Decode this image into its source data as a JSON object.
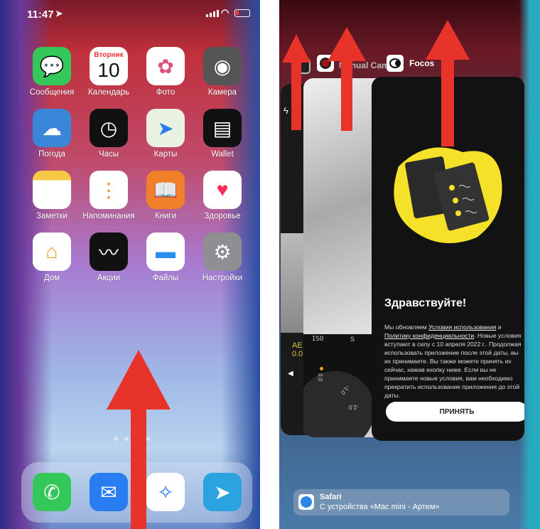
{
  "left_screen": {
    "status_bar": {
      "time": "11:47",
      "location_icon": "location-arrow-icon",
      "signal_icon": "cellular-signal-icon",
      "wifi_icon": "wifi-icon",
      "battery_icon": "battery-low-icon"
    },
    "apps": [
      {
        "label": "Сообщения",
        "icon": "messages-icon",
        "color": "#34c759"
      },
      {
        "label": "Календарь",
        "icon": "calendar-icon",
        "day": "Вторник",
        "date": "10"
      },
      {
        "label": "Фото",
        "icon": "photos-icon"
      },
      {
        "label": "Камера",
        "icon": "camera-icon",
        "color": "#555555"
      },
      {
        "label": "Погода",
        "icon": "weather-icon",
        "color": "#3a86d8"
      },
      {
        "label": "Часы",
        "icon": "clock-icon",
        "color": "#111111"
      },
      {
        "label": "Карты",
        "icon": "maps-icon"
      },
      {
        "label": "Wallet",
        "icon": "wallet-icon",
        "color": "#111111"
      },
      {
        "label": "Заметки",
        "icon": "notes-icon"
      },
      {
        "label": "Напоминания",
        "icon": "reminders-icon"
      },
      {
        "label": "Книги",
        "icon": "books-icon",
        "color": "#f0802a"
      },
      {
        "label": "Здоровье",
        "icon": "health-icon"
      },
      {
        "label": "Дом",
        "icon": "home-icon"
      },
      {
        "label": "Акции",
        "icon": "stocks-icon",
        "color": "#111111"
      },
      {
        "label": "Файлы",
        "icon": "files-icon"
      },
      {
        "label": "Настройки",
        "icon": "settings-icon",
        "color": "#8e8e93"
      }
    ],
    "page_dots": {
      "count": 4,
      "active": 3
    },
    "dock": [
      {
        "icon": "phone-icon",
        "color": "#34c759"
      },
      {
        "icon": "mail-icon",
        "color": "#2a7df0"
      },
      {
        "icon": "safari-icon"
      },
      {
        "icon": "telegram-icon",
        "color": "#2aa3e0"
      }
    ]
  },
  "right_screen": {
    "app_labels": [
      {
        "name": "Manual Cam"
      },
      {
        "name": "Focos"
      }
    ],
    "camera_card": {
      "ae_label": "AE",
      "ae_value": "0.0"
    },
    "manual_card": {
      "iso": "ISO",
      "s": "S",
      "dial": [
        "0.0",
        "-1.0",
        "-2.0"
      ]
    },
    "focos_card": {
      "title": "Здравствуйте!",
      "text_1": "Мы обновляем ",
      "link_terms": "Условия использования",
      "text_2": " и ",
      "link_privacy": "Политику конфиденциальности",
      "text_3": ". Новые условия вступают в силу с 10 апреля 2022 г.. Продолжая использовать приложение после этой даты, вы их принимаете. Вы также можете принять их сейчас, нажав кнопку ниже. Если вы не принимаете новые условия, вам необходимо прекратить использование приложения до этой даты.",
      "accept_button": "ПРИНЯТЬ",
      "accent": "#f5e12a"
    },
    "handoff": {
      "app": "Safari",
      "subtitle": "С устройства «Mac mini - Артем»"
    }
  },
  "arrow_color": "#e8332a"
}
